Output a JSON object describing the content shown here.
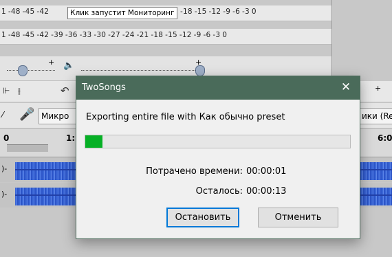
{
  "background_app": {
    "meter_top": {
      "ticks_left": [
        "1",
        "-48",
        "-45",
        "-42"
      ],
      "tooltip": "Клик запустит Мониторинг",
      "ticks_right": [
        "-18",
        "-15",
        "-12",
        "-9",
        "-6",
        "-3",
        "0"
      ]
    },
    "meter_bottom": {
      "ticks": [
        "1",
        "-48",
        "-45",
        "-42",
        "-39",
        "-36",
        "-33",
        "-30",
        "-27",
        "-24",
        "-21",
        "-18",
        "-15",
        "-12",
        "-9",
        "-6",
        "-3",
        "0"
      ]
    },
    "slider_row": {
      "plus_left": "+",
      "plus_right": "+",
      "speaker_icon": "speaker-icon"
    },
    "device_row": {
      "mic_device": "Микро",
      "output_device": "ики (Re"
    },
    "timeline": {
      "tick_0": "0",
      "tick_1": "1:",
      "tick_6": "6:0"
    }
  },
  "dialog": {
    "title": "TwoSongs",
    "close_label": "✕",
    "message": "Exporting entire file with Как обычно preset",
    "progress_fraction": 0.065,
    "elapsed_label": "Потрачено времени:",
    "elapsed_value": "00:00:01",
    "remaining_label": "Осталось:",
    "remaining_value": "00:00:13",
    "stop_button": "Остановить",
    "cancel_button": "Отменить"
  },
  "colors": {
    "titlebar": "#4a6b5a",
    "progress_fill": "#06b025",
    "waveform": "#3b67d6",
    "primary_button_border": "#0078d7"
  }
}
